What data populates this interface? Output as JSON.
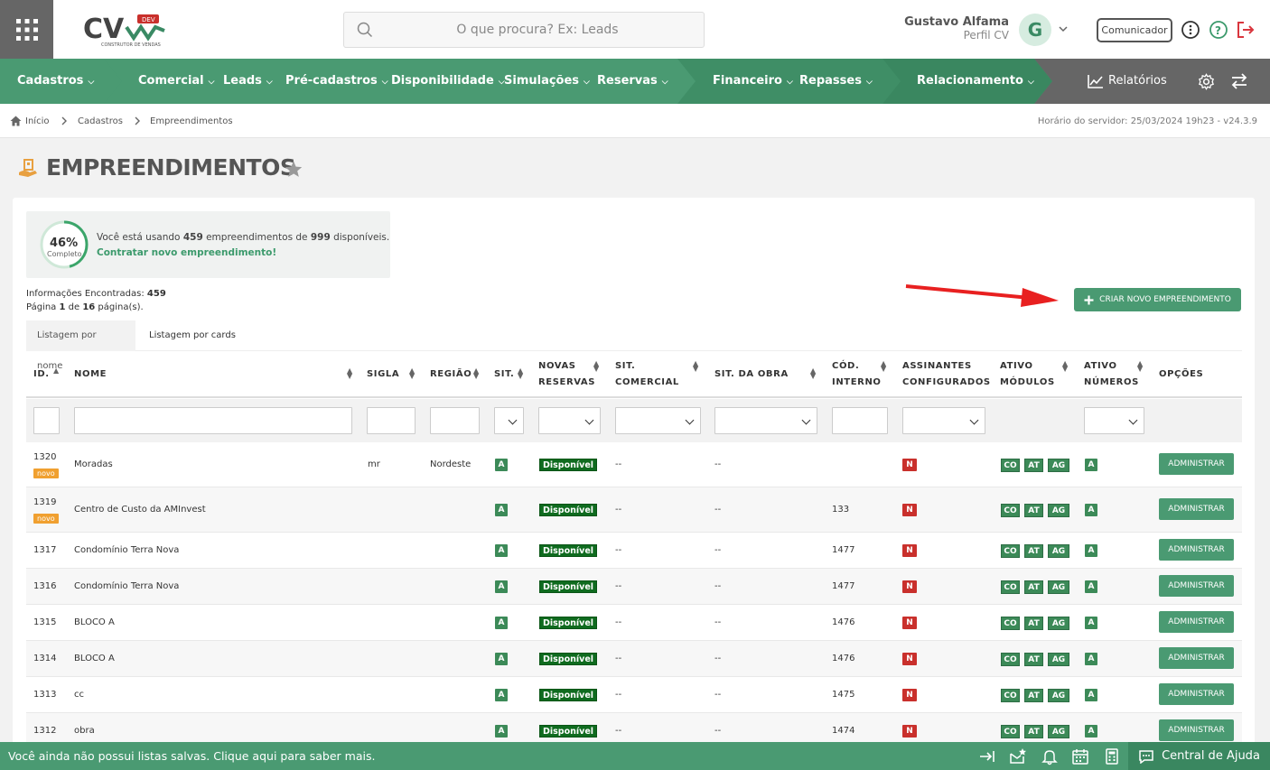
{
  "header": {
    "logo_text": "CV",
    "logo_badge": "DEV",
    "logo_sub": "CONSTRUTOR DE VENDAS",
    "search_placeholder": "O que procura? Ex: Leads",
    "user_name": "Gustavo Alfama",
    "user_profile": "Perfil CV",
    "avatar_letter": "G",
    "comunicador_label": "Comunicador"
  },
  "nav": {
    "items": [
      "Cadastros",
      "Comercial",
      "Leads",
      "Pré-cadastros",
      "Disponibilidade",
      "Simulações",
      "Reservas",
      "Financeiro",
      "Repasses",
      "Relacionamento",
      "Relatórios"
    ]
  },
  "breadcrumb": {
    "home": "Início",
    "level1": "Cadastros",
    "level2": "Empreendimentos",
    "server_time": "Horário do servidor: 25/03/2024 19h23 - v24.3.9"
  },
  "page": {
    "title": "EMPREENDIMENTOS",
    "usage_percent": "46%",
    "usage_percent_value": 46,
    "usage_sub": "Completo",
    "usage_text_pre": "Você está usando ",
    "usage_used": "459",
    "usage_text_mid": " empreendimentos de ",
    "usage_total": "999",
    "usage_text_post": " disponíveis.",
    "usage_link": "Contratar novo empreendimento!",
    "info_label": "Informações Encontradas: ",
    "info_count": "459",
    "page_pre": "Página ",
    "page_num": "1",
    "page_mid": " de ",
    "page_total": "16",
    "page_post": " página(s).",
    "new_button": "CRIAR NOVO EMPREENDIMENTO",
    "tab_by_name": "Listagem por nome",
    "tab_by_cards": "Listagem por cards"
  },
  "table": {
    "headers": {
      "id": "ID.",
      "nome": "NOME",
      "sigla": "SIGLA",
      "regiao": "REGIÃO",
      "sit": "SIT.",
      "novas1": "NOVAS",
      "novas2": "RESERVAS",
      "sitcom1": "SIT.",
      "sitcom2": "COMERCIAL",
      "sitobra": "SIT. DA OBRA",
      "cod1": "CÓD.",
      "cod2": "INTERNO",
      "ass1": "ASSINANTES",
      "ass2": "CONFIGURADOS",
      "mod1": "ATIVO",
      "mod2": "MÓDULOS",
      "num1": "ATIVO",
      "num2": "NÚMEROS",
      "opcoes": "OPÇÕES"
    },
    "rows": [
      {
        "id": "1320",
        "novo": "novo",
        "nome": "Moradas",
        "sigla": "mr",
        "regiao": "Nordeste",
        "sit": "A",
        "novas": "Disponível",
        "sitcom": "--",
        "sitobra": "--",
        "cod": "",
        "ass": "N",
        "m1": "CO",
        "m2": "AT",
        "m3": "AG",
        "num": "A",
        "btn": "ADMINISTRAR"
      },
      {
        "id": "1319",
        "novo": "novo",
        "nome": "Centro de Custo da AMInvest",
        "sigla": "",
        "regiao": "",
        "sit": "A",
        "novas": "Disponível",
        "sitcom": "--",
        "sitobra": "--",
        "cod": "133",
        "ass": "N",
        "m1": "CO",
        "m2": "AT",
        "m3": "AG",
        "num": "A",
        "btn": "ADMINISTRAR"
      },
      {
        "id": "1317",
        "novo": "",
        "nome": "Condomínio Terra Nova",
        "sigla": "",
        "regiao": "",
        "sit": "A",
        "novas": "Disponível",
        "sitcom": "--",
        "sitobra": "--",
        "cod": "1477",
        "ass": "N",
        "m1": "CO",
        "m2": "AT",
        "m3": "AG",
        "num": "A",
        "btn": "ADMINISTRAR"
      },
      {
        "id": "1316",
        "novo": "",
        "nome": "Condomínio Terra Nova",
        "sigla": "",
        "regiao": "",
        "sit": "A",
        "novas": "Disponível",
        "sitcom": "--",
        "sitobra": "--",
        "cod": "1477",
        "ass": "N",
        "m1": "CO",
        "m2": "AT",
        "m3": "AG",
        "num": "A",
        "btn": "ADMINISTRAR"
      },
      {
        "id": "1315",
        "novo": "",
        "nome": "BLOCO A",
        "sigla": "",
        "regiao": "",
        "sit": "A",
        "novas": "Disponível",
        "sitcom": "--",
        "sitobra": "--",
        "cod": "1476",
        "ass": "N",
        "m1": "CO",
        "m2": "AT",
        "m3": "AG",
        "num": "A",
        "btn": "ADMINISTRAR"
      },
      {
        "id": "1314",
        "novo": "",
        "nome": "BLOCO A",
        "sigla": "",
        "regiao": "",
        "sit": "A",
        "novas": "Disponível",
        "sitcom": "--",
        "sitobra": "--",
        "cod": "1476",
        "ass": "N",
        "m1": "CO",
        "m2": "AT",
        "m3": "AG",
        "num": "A",
        "btn": "ADMINISTRAR"
      },
      {
        "id": "1313",
        "novo": "",
        "nome": "cc",
        "sigla": "",
        "regiao": "",
        "sit": "A",
        "novas": "Disponível",
        "sitcom": "--",
        "sitobra": "--",
        "cod": "1475",
        "ass": "N",
        "m1": "CO",
        "m2": "AT",
        "m3": "AG",
        "num": "A",
        "btn": "ADMINISTRAR"
      },
      {
        "id": "1312",
        "novo": "",
        "nome": "obra",
        "sigla": "",
        "regiao": "",
        "sit": "A",
        "novas": "Disponível",
        "sitcom": "--",
        "sitobra": "--",
        "cod": "1474",
        "ass": "N",
        "m1": "CO",
        "m2": "AT",
        "m3": "AG",
        "num": "A",
        "btn": "ADMINISTRAR"
      }
    ]
  },
  "footer": {
    "message": "Você ainda não possui listas salvas. Clique aqui para saber mais.",
    "help": "Central de Ajuda"
  },
  "colors": {
    "primary": "#4a9a72",
    "nav_dark": "#3a8760",
    "danger": "#c9302c",
    "badge_green": "#0f6b1f"
  }
}
